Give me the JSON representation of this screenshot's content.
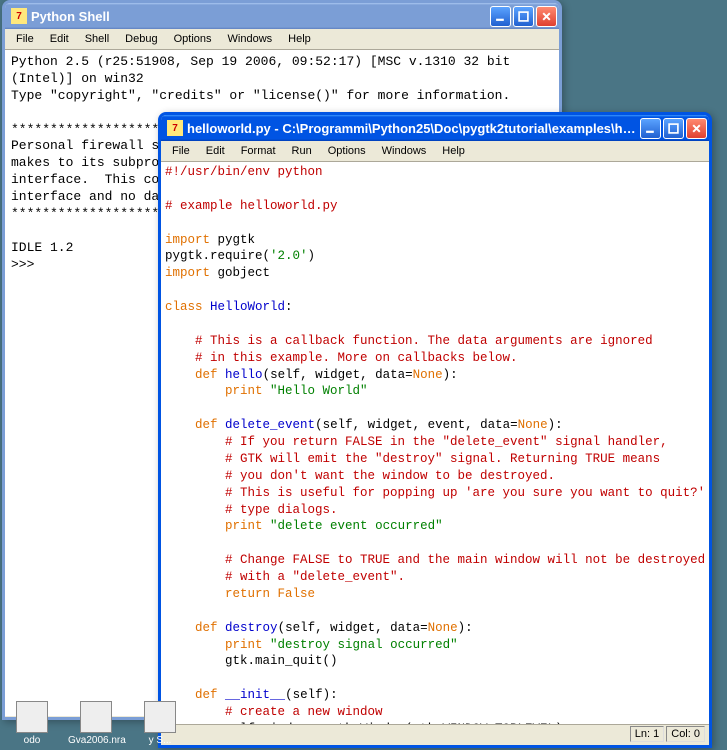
{
  "shell_window": {
    "title": "Python Shell",
    "menu": [
      "File",
      "Edit",
      "Shell",
      "Debug",
      "Options",
      "Windows",
      "Help"
    ],
    "lines": [
      "Python 2.5 (r25:51908, Sep 19 2006, 09:52:17) [MSC v.1310 32 bit (Intel)] on win32",
      "Type \"copyright\", \"credits\" or \"license()\" for more information.",
      "",
      "****************************************************************",
      "Personal firewall software may warn about the connection IDLE",
      "makes to its subprocess using this computer's internal loopback",
      "interface.  This connection is not visible on any external",
      "interface and no data is sent to or received from the Internet.",
      "****************************************************************",
      "",
      "IDLE 1.2",
      ">>> "
    ]
  },
  "editor_window": {
    "title": "helloworld.py - C:\\Programmi\\Python25\\Doc\\pygtk2tutorial\\examples\\hellowo...",
    "menu": [
      "File",
      "Edit",
      "Format",
      "Run",
      "Options",
      "Windows",
      "Help"
    ],
    "status": {
      "line": "Ln: 1",
      "col": "Col: 0"
    },
    "code": [
      {
        "t": "#!/usr/bin/env python",
        "c": "cm"
      },
      {
        "t": "",
        "c": "nm"
      },
      {
        "t": "# example helloworld.py",
        "c": "cm"
      },
      {
        "t": "",
        "c": "nm"
      },
      {
        "parts": [
          {
            "t": "import",
            "c": "kw"
          },
          {
            "t": " pygtk",
            "c": "nm"
          }
        ]
      },
      {
        "parts": [
          {
            "t": "pygtk.require(",
            "c": "nm"
          },
          {
            "t": "'2.0'",
            "c": "str"
          },
          {
            "t": ")",
            "c": "nm"
          }
        ]
      },
      {
        "parts": [
          {
            "t": "import",
            "c": "kw"
          },
          {
            "t": " gobject",
            "c": "nm"
          }
        ]
      },
      {
        "t": "",
        "c": "nm"
      },
      {
        "parts": [
          {
            "t": "class",
            "c": "kw"
          },
          {
            "t": " ",
            "c": "nm"
          },
          {
            "t": "HelloWorld",
            "c": "fn"
          },
          {
            "t": ":",
            "c": "nm"
          }
        ]
      },
      {
        "t": "",
        "c": "nm"
      },
      {
        "t": "    # This is a callback function. The data arguments are ignored",
        "c": "cm"
      },
      {
        "t": "    # in this example. More on callbacks below.",
        "c": "cm"
      },
      {
        "parts": [
          {
            "t": "    ",
            "c": "nm"
          },
          {
            "t": "def",
            "c": "kw"
          },
          {
            "t": " ",
            "c": "nm"
          },
          {
            "t": "hello",
            "c": "fn"
          },
          {
            "t": "(self, widget, data=",
            "c": "nm"
          },
          {
            "t": "None",
            "c": "kw"
          },
          {
            "t": "):",
            "c": "nm"
          }
        ]
      },
      {
        "parts": [
          {
            "t": "        ",
            "c": "nm"
          },
          {
            "t": "print",
            "c": "kw"
          },
          {
            "t": " ",
            "c": "nm"
          },
          {
            "t": "\"Hello World\"",
            "c": "str"
          }
        ]
      },
      {
        "t": "",
        "c": "nm"
      },
      {
        "parts": [
          {
            "t": "    ",
            "c": "nm"
          },
          {
            "t": "def",
            "c": "kw"
          },
          {
            "t": " ",
            "c": "nm"
          },
          {
            "t": "delete_event",
            "c": "fn"
          },
          {
            "t": "(self, widget, event, data=",
            "c": "nm"
          },
          {
            "t": "None",
            "c": "kw"
          },
          {
            "t": "):",
            "c": "nm"
          }
        ]
      },
      {
        "t": "        # If you return FALSE in the \"delete_event\" signal handler,",
        "c": "cm"
      },
      {
        "t": "        # GTK will emit the \"destroy\" signal. Returning TRUE means",
        "c": "cm"
      },
      {
        "t": "        # you don't want the window to be destroyed.",
        "c": "cm"
      },
      {
        "t": "        # This is useful for popping up 'are you sure you want to quit?'",
        "c": "cm"
      },
      {
        "t": "        # type dialogs.",
        "c": "cm"
      },
      {
        "parts": [
          {
            "t": "        ",
            "c": "nm"
          },
          {
            "t": "print",
            "c": "kw"
          },
          {
            "t": " ",
            "c": "nm"
          },
          {
            "t": "\"delete event occurred\"",
            "c": "str"
          }
        ]
      },
      {
        "t": "",
        "c": "nm"
      },
      {
        "t": "        # Change FALSE to TRUE and the main window will not be destroyed",
        "c": "cm"
      },
      {
        "t": "        # with a \"delete_event\".",
        "c": "cm"
      },
      {
        "parts": [
          {
            "t": "        ",
            "c": "nm"
          },
          {
            "t": "return",
            "c": "kw"
          },
          {
            "t": " ",
            "c": "nm"
          },
          {
            "t": "False",
            "c": "kw"
          }
        ]
      },
      {
        "t": "",
        "c": "nm"
      },
      {
        "parts": [
          {
            "t": "    ",
            "c": "nm"
          },
          {
            "t": "def",
            "c": "kw"
          },
          {
            "t": " ",
            "c": "nm"
          },
          {
            "t": "destroy",
            "c": "fn"
          },
          {
            "t": "(self, widget, data=",
            "c": "nm"
          },
          {
            "t": "None",
            "c": "kw"
          },
          {
            "t": "):",
            "c": "nm"
          }
        ]
      },
      {
        "parts": [
          {
            "t": "        ",
            "c": "nm"
          },
          {
            "t": "print",
            "c": "kw"
          },
          {
            "t": " ",
            "c": "nm"
          },
          {
            "t": "\"destroy signal occurred\"",
            "c": "str"
          }
        ]
      },
      {
        "t": "        gtk.main_quit()",
        "c": "nm"
      },
      {
        "t": "",
        "c": "nm"
      },
      {
        "parts": [
          {
            "t": "    ",
            "c": "nm"
          },
          {
            "t": "def",
            "c": "kw"
          },
          {
            "t": " ",
            "c": "nm"
          },
          {
            "t": "__init__",
            "c": "fn"
          },
          {
            "t": "(self):",
            "c": "nm"
          }
        ]
      },
      {
        "t": "        # create a new window",
        "c": "cm"
      },
      {
        "t": "        self.window = gtk.Window(gtk.WINDOW_TOPLEVEL)",
        "c": "nm"
      },
      {
        "t": "",
        "c": "nm"
      }
    ]
  },
  "desktop": {
    "icons": [
      "odo",
      "Gva2006.nra",
      "y S..."
    ]
  }
}
